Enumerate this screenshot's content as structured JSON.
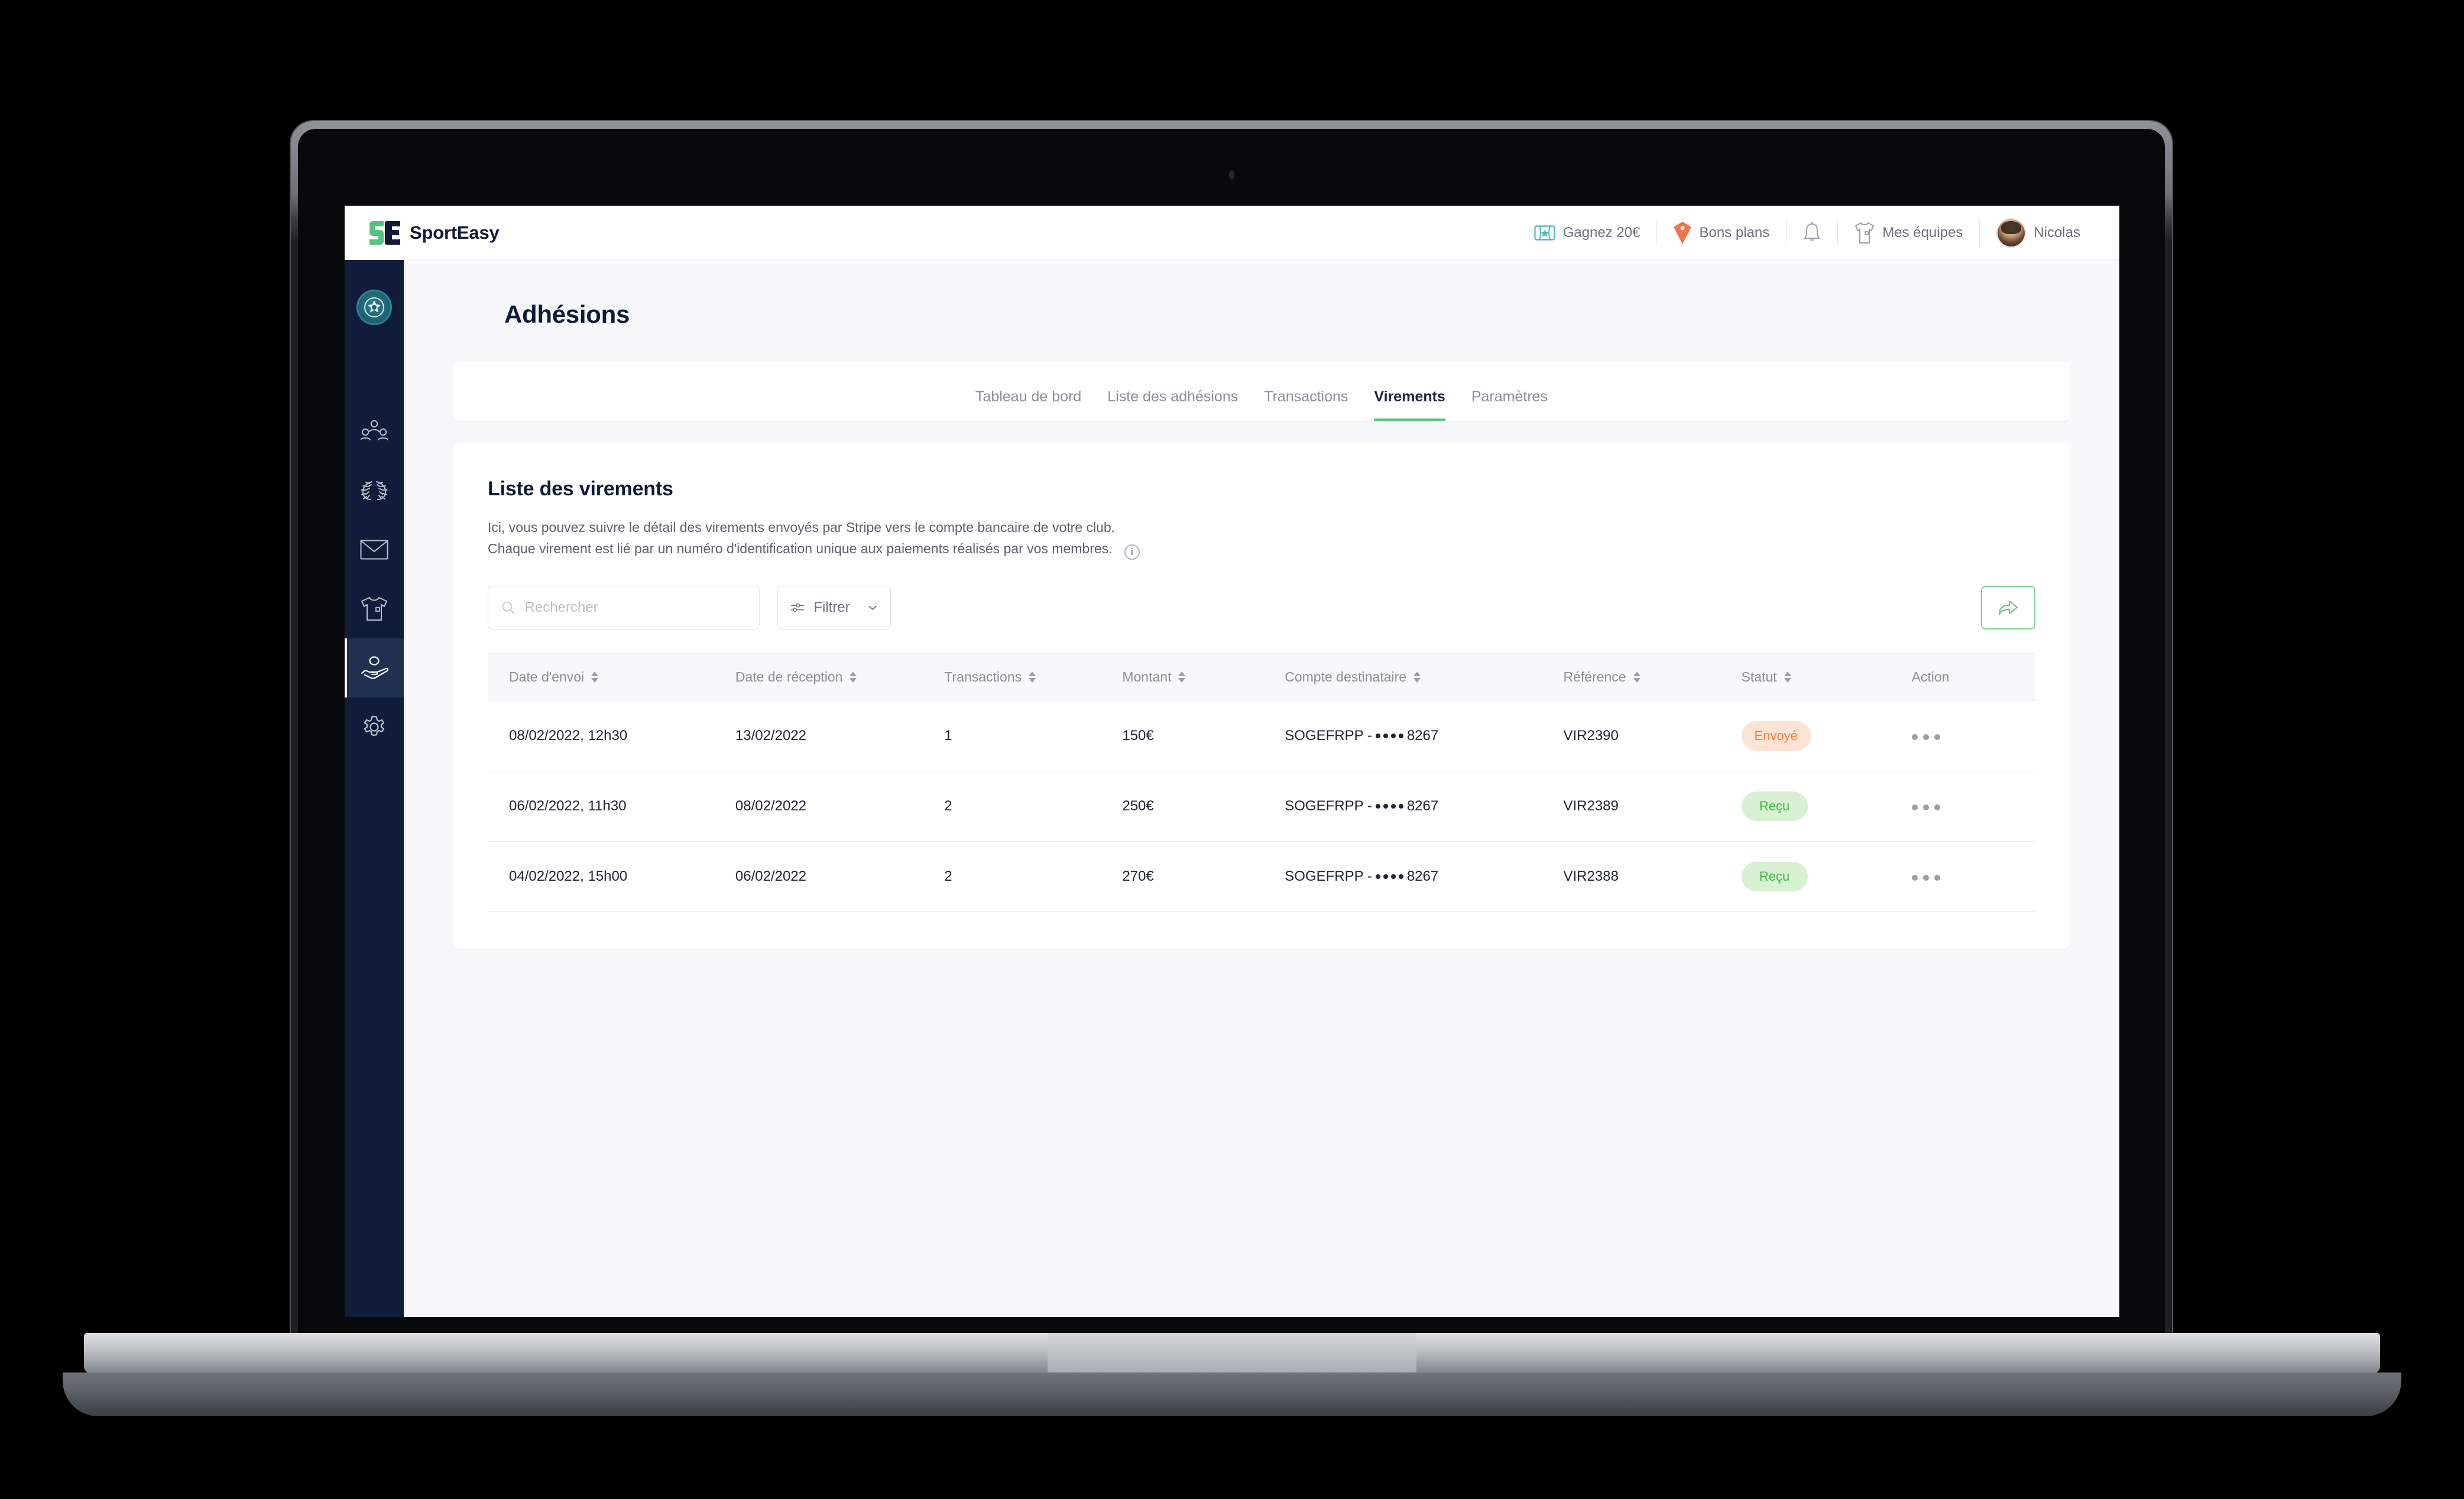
{
  "header": {
    "brand_name": "SportEasy",
    "items": [
      {
        "icon": "ticket-icon",
        "label": "Gagnez 20€"
      },
      {
        "icon": "tag-icon",
        "label": "Bons plans"
      },
      {
        "icon": "bell-icon",
        "label": ""
      },
      {
        "icon": "tshirt-icon",
        "label": "Mes équipes"
      },
      {
        "icon": "avatar",
        "label": "Nicolas"
      }
    ]
  },
  "sidebar": {
    "club_logo": "club-crest-icon",
    "items": [
      {
        "icon": "members-icon",
        "name": "members",
        "active": false
      },
      {
        "icon": "laurel-wreath-icon",
        "name": "competitions",
        "active": false
      },
      {
        "icon": "envelope-icon",
        "name": "messages",
        "active": false
      },
      {
        "icon": "tshirt-icon",
        "name": "equipment",
        "active": false
      },
      {
        "icon": "hand-coin-icon",
        "name": "memberships",
        "active": true
      },
      {
        "icon": "gear-icon",
        "name": "settings",
        "active": false
      }
    ]
  },
  "page": {
    "title": "Adhésions",
    "tabs": [
      {
        "label": "Tableau de bord",
        "active": false
      },
      {
        "label": "Liste des adhésions",
        "active": false
      },
      {
        "label": "Transactions",
        "active": false
      },
      {
        "label": "Virements",
        "active": true
      },
      {
        "label": "Paramètres",
        "active": false
      }
    ]
  },
  "card": {
    "title": "Liste des virements",
    "desc_line1": "Ici, vous pouvez suivre le détail des virements envoyés par Stripe vers le compte bancaire de votre club.",
    "desc_line2": "Chaque virement est lié par un numéro d'identification unique aux paiements réalisés par vos membres.",
    "info_glyph": "i"
  },
  "toolbar": {
    "search_placeholder": "Rechercher",
    "search_value": "",
    "filter_label": "Filtrer",
    "export_icon": "share-arrow-icon"
  },
  "table": {
    "columns": [
      {
        "label": "Date d'envoi",
        "sortable": true
      },
      {
        "label": "Date de réception",
        "sortable": true
      },
      {
        "label": "Transactions",
        "sortable": true
      },
      {
        "label": "Montant",
        "sortable": true
      },
      {
        "label": "Compte destinataire",
        "sortable": true
      },
      {
        "label": "Référence",
        "sortable": true
      },
      {
        "label": "Statut",
        "sortable": true
      },
      {
        "label": "Action",
        "sortable": false
      }
    ],
    "rows": [
      {
        "date_envoi": "08/02/2022, 12h30",
        "date_reception": "13/02/2022",
        "transactions": "1",
        "montant": "150€",
        "compte_prefix": "SOGEFRPP -",
        "compte_suffix": "8267",
        "reference": "VIR2390",
        "statut": "Envoyé",
        "statut_kind": "sent"
      },
      {
        "date_envoi": "06/02/2022, 11h30",
        "date_reception": "08/02/2022",
        "transactions": "2",
        "montant": "250€",
        "compte_prefix": "SOGEFRPP -",
        "compte_suffix": "8267",
        "reference": "VIR2389",
        "statut": "Reçu",
        "statut_kind": "received"
      },
      {
        "date_envoi": "04/02/2022, 15h00",
        "date_reception": "06/02/2022",
        "transactions": "2",
        "montant": "270€",
        "compte_prefix": "SOGEFRPP -",
        "compte_suffix": "8267",
        "reference": "VIR2388",
        "statut": "Reçu",
        "statut_kind": "received"
      }
    ]
  },
  "colors": {
    "brand_green": "#5ec27f",
    "sidebar_navy": "#101c3a",
    "sidebar_active": "#20304f",
    "status_sent_fg": "#f4803c",
    "status_sent_bg": "#fde3d3",
    "status_received_fg": "#45b54c",
    "status_received_bg": "#d8f1d2",
    "page_bg": "#f7f8fa"
  }
}
